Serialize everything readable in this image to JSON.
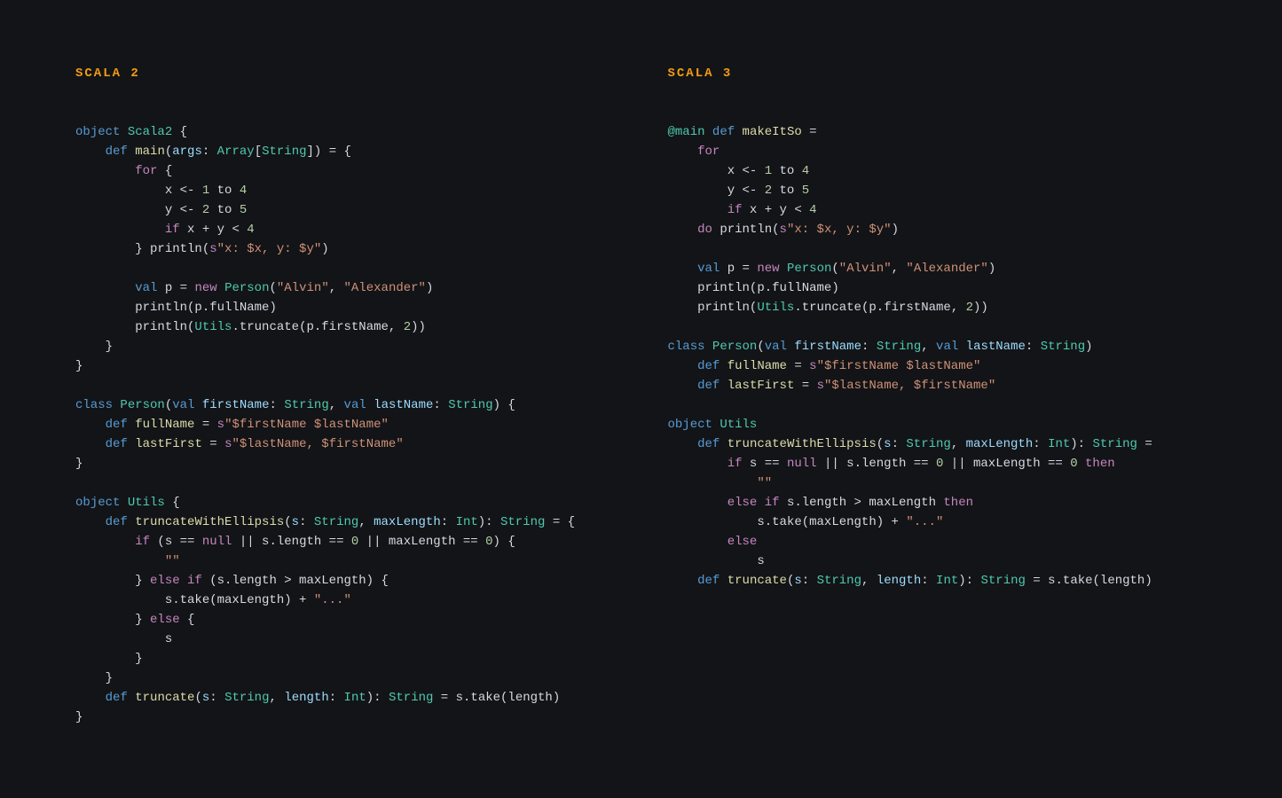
{
  "left": {
    "title": "SCALA 2",
    "code": {
      "obj_name": "Scala2",
      "main_name": "main",
      "main_arg": "args",
      "array_type": "Array",
      "string_type": "String",
      "range1_a": "1",
      "range1_b": "4",
      "range2_a": "2",
      "range2_b": "5",
      "cond_rhs": "4",
      "println_interp": "\"x: $x, y: $y\"",
      "person_type": "Person",
      "alvin": "\"Alvin\"",
      "alexander": "\"Alexander\"",
      "fullname": "fullName",
      "utils": "Utils",
      "truncate": "truncate",
      "firstname": "firstName",
      "two": "2",
      "class_name": "Person",
      "lastname": "lastName",
      "fullname_interp": "\"$firstName $lastName\"",
      "lastfirst": "lastFirst",
      "lastfirst_interp": "\"$lastName, $firstName\"",
      "utils_obj": "Utils",
      "twe": "truncateWithEllipsis",
      "maxlen": "maxLength",
      "int_type": "Int",
      "zero": "0",
      "empty": "\"\"",
      "dots": "\"...\"",
      "trunc2": "truncate",
      "length": "length"
    }
  },
  "right": {
    "title": "SCALA 3",
    "code": {
      "at_main": "@main",
      "make": "makeItSo",
      "range1_a": "1",
      "range1_b": "4",
      "range2_a": "2",
      "range2_b": "5",
      "cond_rhs": "4",
      "println_interp": "\"x: $x, y: $y\"",
      "person_type": "Person",
      "alvin": "\"Alvin\"",
      "alexander": "\"Alexander\"",
      "fullname": "fullName",
      "utils": "Utils",
      "truncate": "truncate",
      "firstname": "firstName",
      "two": "2",
      "class_name": "Person",
      "lastname": "lastName",
      "string_type": "String",
      "fullname_interp": "\"$firstName $lastName\"",
      "lastfirst": "lastFirst",
      "lastfirst_interp": "\"$lastName, $firstName\"",
      "utils_obj": "Utils",
      "twe": "truncateWithEllipsis",
      "maxlen": "maxLength",
      "int_type": "Int",
      "zero": "0",
      "empty": "\"\"",
      "dots": "\"...\"",
      "trunc2": "truncate",
      "length": "length"
    }
  }
}
